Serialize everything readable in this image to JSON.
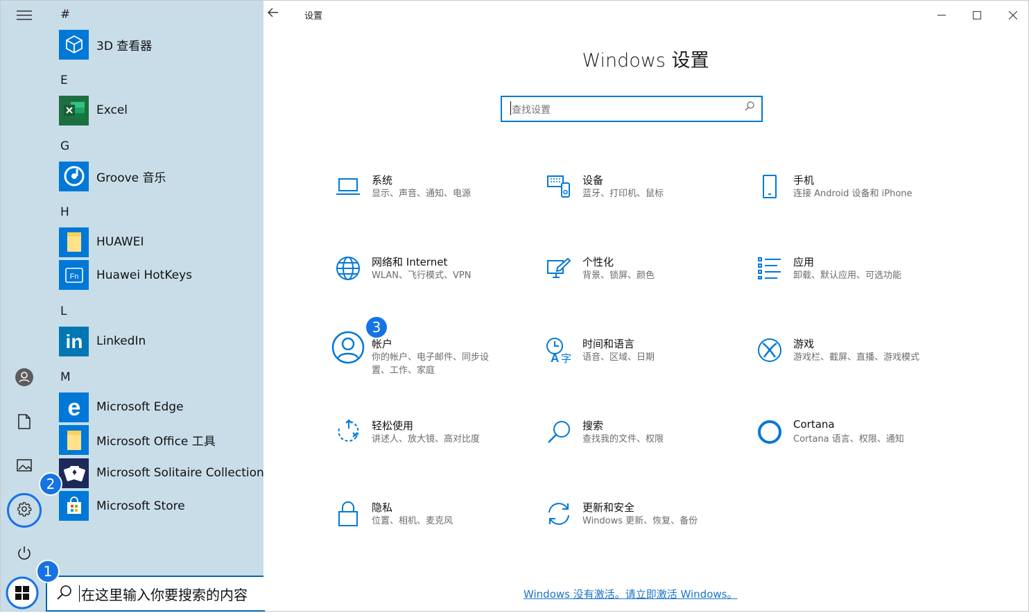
{
  "start_menu": {
    "sections": [
      {
        "letter": "#",
        "apps": [
          {
            "name": "3D 查看器",
            "icon": "cube-icon",
            "color": "#0078d7"
          }
        ]
      },
      {
        "letter": "E",
        "apps": [
          {
            "name": "Excel",
            "icon": "excel-icon",
            "color": "#1d6f42"
          }
        ]
      },
      {
        "letter": "G",
        "apps": [
          {
            "name": "Groove 音乐",
            "icon": "groove-icon",
            "color": "#0078d7"
          }
        ]
      },
      {
        "letter": "H",
        "apps": [
          {
            "name": "HUAWEI",
            "icon": "folder-icon",
            "color": "#0078d7"
          },
          {
            "name": "Huawei HotKeys",
            "icon": "fn-key-icon",
            "color": "#0078d7"
          }
        ]
      },
      {
        "letter": "L",
        "apps": [
          {
            "name": "LinkedIn",
            "icon": "linkedin-icon",
            "color": "#0077b5"
          }
        ]
      },
      {
        "letter": "M",
        "apps": [
          {
            "name": "Microsoft Edge",
            "icon": "edge-icon",
            "color": "#0078d7"
          },
          {
            "name": "Microsoft Office 工具",
            "icon": "folder-icon",
            "color": "#0078d7"
          },
          {
            "name": "Microsoft Solitaire Collection",
            "icon": "cards-icon",
            "color": "#1b2a5a"
          },
          {
            "name": "Microsoft Store",
            "icon": "store-icon",
            "color": "#0078d7"
          }
        ]
      }
    ],
    "search_text": "在这里输入你要搜索的内容"
  },
  "badges": {
    "start": "1",
    "settings": "2",
    "accounts": "3"
  },
  "window": {
    "title": "设置",
    "heading": "Windows 设置",
    "search_placeholder": "查找设置",
    "items": [
      {
        "title": "系统",
        "desc": "显示、声音、通知、电源",
        "icon": "laptop-icon"
      },
      {
        "title": "设备",
        "desc": "蓝牙、打印机、鼠标",
        "icon": "devices-icon"
      },
      {
        "title": "手机",
        "desc": "连接 Android 设备和 iPhone",
        "icon": "phone-icon"
      },
      {
        "title": "网络和 Internet",
        "desc": "WLAN、飞行模式、VPN",
        "icon": "globe-icon"
      },
      {
        "title": "个性化",
        "desc": "背景、锁屏、颜色",
        "icon": "personalize-icon"
      },
      {
        "title": "应用",
        "desc": "卸载、默认应用、可选功能",
        "icon": "apps-list-icon"
      },
      {
        "title": "帐户",
        "desc": "你的帐户、电子邮件、同步设置、工作、家庭",
        "icon": "person-icon"
      },
      {
        "title": "时间和语言",
        "desc": "语音、区域、日期",
        "icon": "time-language-icon"
      },
      {
        "title": "游戏",
        "desc": "游戏栏、截屏、直播、游戏模式",
        "icon": "xbox-icon"
      },
      {
        "title": "轻松使用",
        "desc": "讲述人、放大镜、高对比度",
        "icon": "ease-of-access-icon"
      },
      {
        "title": "搜索",
        "desc": "查找我的文件、权限",
        "icon": "search-icon"
      },
      {
        "title": "Cortana",
        "desc": "Cortana 语言、权限、通知",
        "icon": "cortana-icon"
      },
      {
        "title": "隐私",
        "desc": "位置、相机、麦克风",
        "icon": "lock-icon"
      },
      {
        "title": "更新和安全",
        "desc": "Windows 更新、恢复、备份",
        "icon": "sync-icon"
      }
    ],
    "activate_link": "Windows 没有激活。请立即激活 Windows。"
  },
  "colors": {
    "accent": "#0078d7",
    "start_bg": "#c9dde9",
    "badge": "#1573e6"
  }
}
